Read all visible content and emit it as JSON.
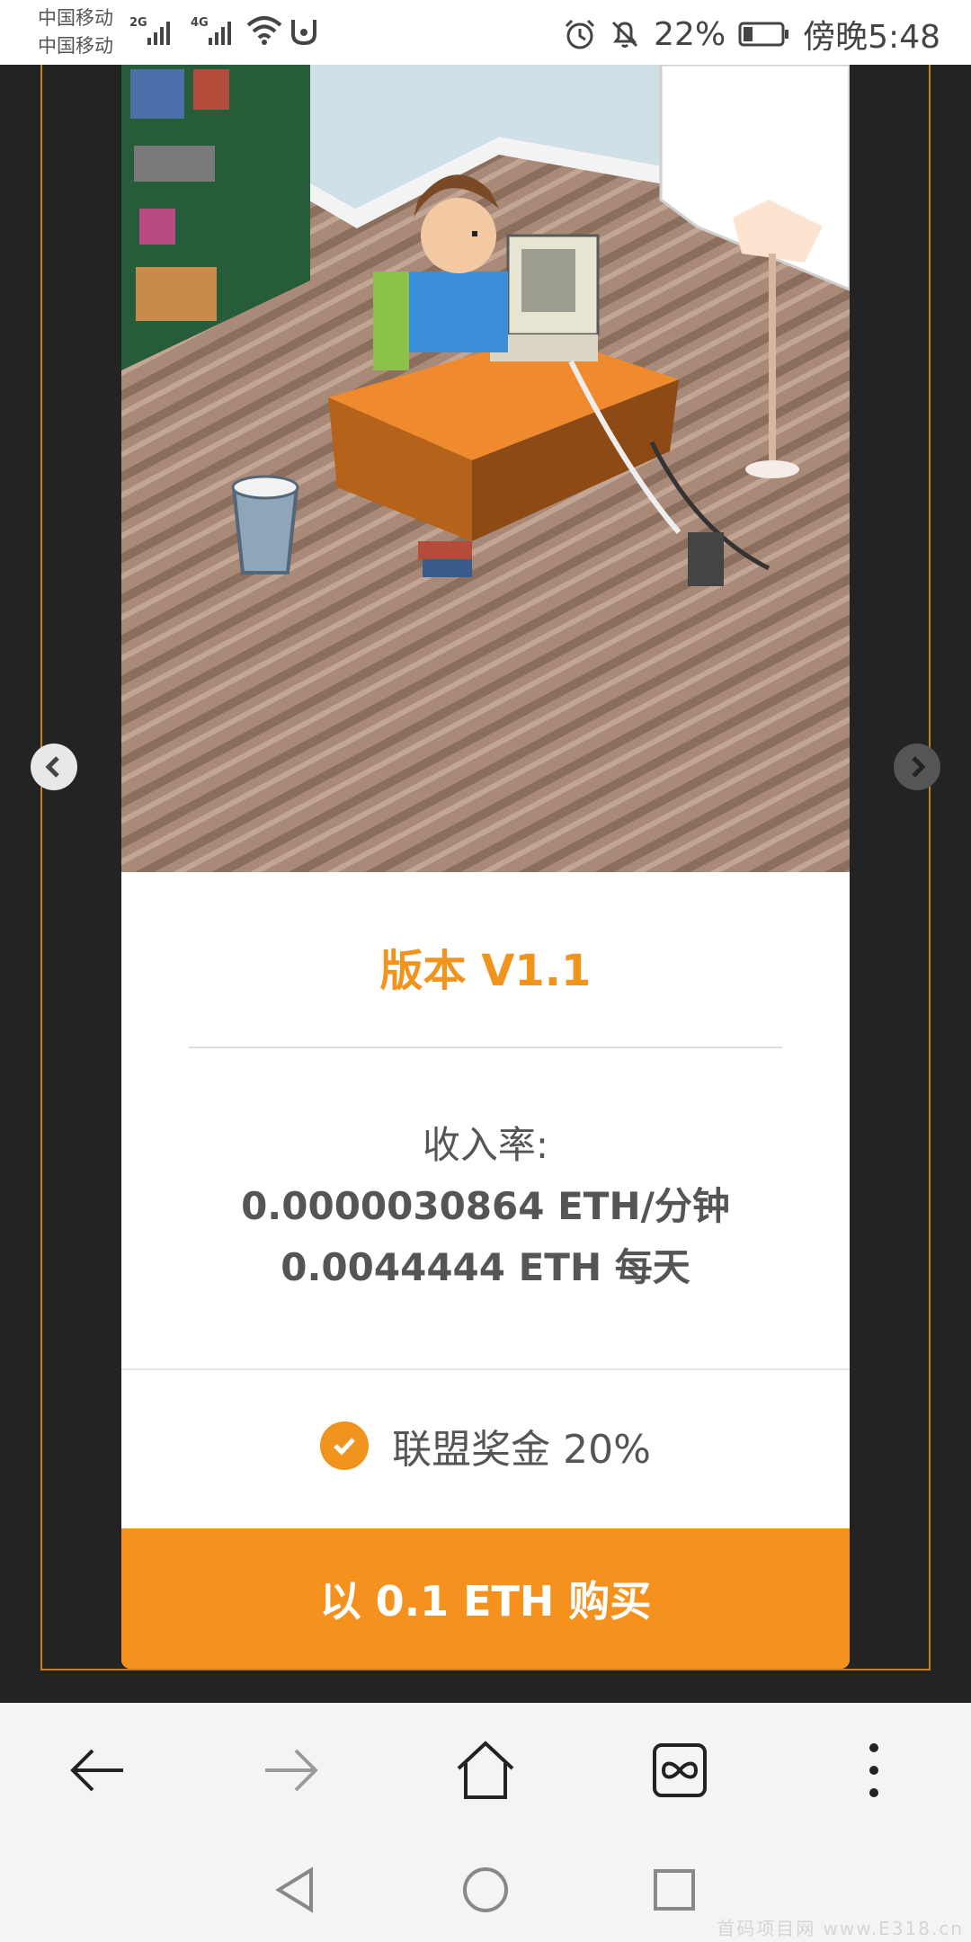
{
  "status_bar": {
    "carrier_1": "中国移动",
    "carrier_2": "中国移动",
    "network_1": "2G",
    "network_2": "4G",
    "battery": "22%",
    "time": "傍晚5:48"
  },
  "miner": {
    "version": "版本 V1.1",
    "rate_label": "收入率:",
    "rate_per_minute": "0.0000030864 ETH/分钟",
    "rate_per_day": "0.0044444 ETH 每天",
    "bonus": "联盟奖金 20%",
    "buy_label": "以 0.1 ETH 购买"
  },
  "watermark": "首码项目网 www.E318.cn",
  "colors": {
    "accent": "#f5921e",
    "background": "#232323"
  },
  "icons": {
    "browser": [
      "back-arrow-icon",
      "forward-arrow-icon",
      "home-icon",
      "tabs-infinity-icon",
      "more-vertical-icon"
    ],
    "system_nav": [
      "nav-back-triangle-icon",
      "nav-home-circle-icon",
      "nav-recent-square-icon"
    ]
  }
}
